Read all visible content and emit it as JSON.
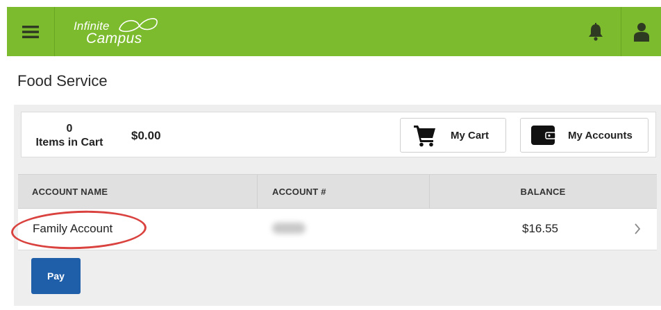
{
  "header": {
    "menu_icon": "hamburger-menu-icon",
    "logo_line1": "Infinite",
    "logo_line2": "Campus",
    "bell_icon": "bell-icon",
    "user_icon": "user-icon",
    "brand_color": "#7cbb2d"
  },
  "page": {
    "title": "Food Service"
  },
  "cart": {
    "count": "0",
    "count_label": "Items in Cart",
    "total": "$0.00",
    "my_cart_label": "My Cart",
    "my_cart_icon": "shopping-cart-icon",
    "my_accounts_label": "My Accounts",
    "my_accounts_icon": "wallet-icon"
  },
  "table": {
    "headers": [
      "ACCOUNT NAME",
      "ACCOUNT #",
      "BALANCE"
    ],
    "rows": [
      {
        "name": "Family Account",
        "number": "",
        "balance": "$16.55"
      }
    ]
  },
  "actions": {
    "pay_label": "Pay",
    "pay_color": "#1f5ea8"
  },
  "annotation_color": "#d9423e"
}
